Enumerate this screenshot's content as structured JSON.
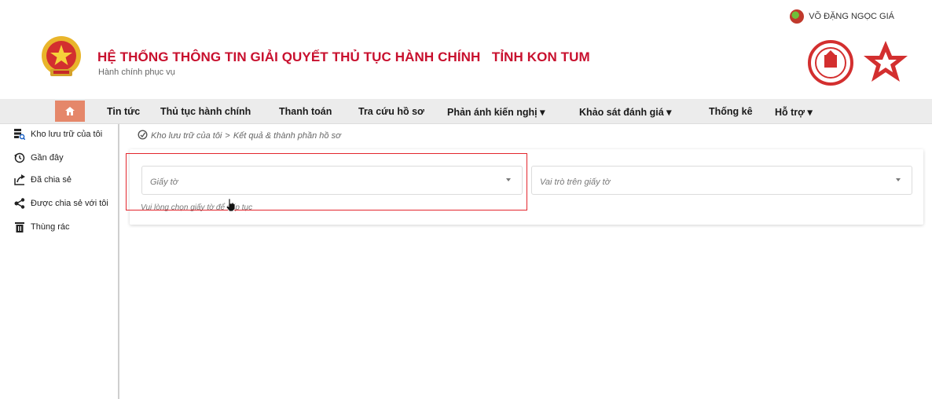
{
  "user": {
    "name": "VÕ ĐẶNG NGỌC GIÁ"
  },
  "header": {
    "title": "HỆ THỐNG THÔNG TIN GIẢI QUYẾT THỦ TỤC HÀNH CHÍNH   TỈNH KON TUM",
    "subtitle": "Hành chính phục vụ"
  },
  "nav": {
    "items": [
      {
        "label": "Tin tức"
      },
      {
        "label": "Thủ tục hành chính"
      },
      {
        "label": "Thanh toán"
      },
      {
        "label": "Tra cứu hồ sơ"
      },
      {
        "label": "Phản ánh kiến nghị ▾"
      },
      {
        "label": "Khảo sát đánh giá ▾"
      },
      {
        "label": "Thống kê"
      },
      {
        "label": "Hỗ trợ ▾"
      }
    ]
  },
  "sidebar": {
    "items": [
      {
        "label": "Kho lưu trữ của tôi",
        "icon": "storage-icon"
      },
      {
        "label": "Gần đây",
        "icon": "history-icon"
      },
      {
        "label": "Đã chia sẻ",
        "icon": "share-out-icon"
      },
      {
        "label": "Được chia sẻ với tôi",
        "icon": "shared-with-me-icon"
      },
      {
        "label": "Thùng rác",
        "icon": "trash-icon"
      }
    ]
  },
  "breadcrumb": {
    "root": "Kho lưu trữ của tôi",
    "separator": ">",
    "current": "Kết quả & thành phần hồ sơ"
  },
  "form": {
    "document_placeholder": "Giấy tờ",
    "role_placeholder": "Vai trò trên giấy tờ",
    "hint": "Vui lòng chọn giấy tờ để tiếp tục"
  },
  "colors": {
    "brand_red": "#c8102e",
    "home_button": "#e5876a",
    "highlight_border": "#e3262d"
  }
}
